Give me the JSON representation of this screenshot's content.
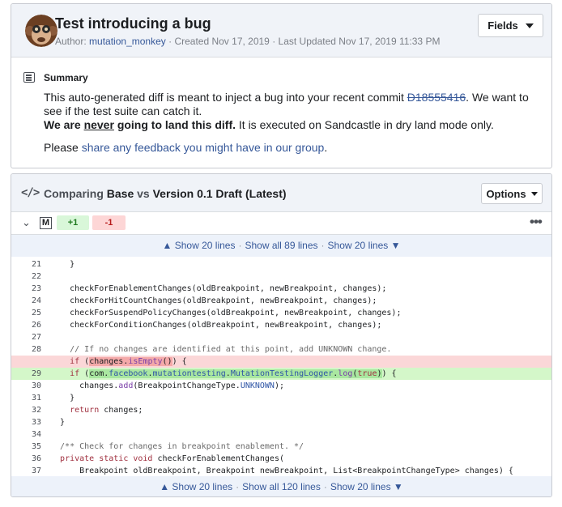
{
  "revision": {
    "title": "Test introducing a bug",
    "author_prefix": "Author:",
    "author": "mutation_monkey",
    "created": "· Created Nov 17, 2019",
    "updated": "· Last Updated Nov 17, 2019 11:33 PM",
    "fields_label": "Fields"
  },
  "summary": {
    "label": "Summary",
    "line1_a": "This auto-generated diff is meant to inject a bug into your recent commit",
    "commit_ref": "D18555416",
    "line1_b": ". We want to see if the test suite can catch it.",
    "bold_a": "We are",
    "bold_never": "never",
    "bold_b": "going to land this diff.",
    "line2_rest": "It is executed on Sandcastle in dry land mode only.",
    "feedback_prefix": "Please",
    "feedback_link": "share any feedback you might have in our group",
    "feedback_suffix": "."
  },
  "diff": {
    "comparing": "Comparing",
    "base": "Base",
    "vs": "vs",
    "version": "Version 0.1 Draft (Latest)",
    "options_label": "Options",
    "file_badge": "M",
    "additions": "+1",
    "deletions": "-1",
    "more_icon": "ellipsis-icon",
    "top_expand": {
      "up": "▲ Show 20 lines",
      "all": "Show all 89 lines",
      "down": "Show 20 lines ▼"
    },
    "bottom_expand": {
      "up": "▲ Show 20 lines",
      "all": "Show all 120 lines",
      "down": "Show 20 lines ▼"
    }
  },
  "colors": {
    "header_bg": "#f0f3f8",
    "link": "#365899",
    "removed_line": "#fbd7d8",
    "added_line": "#d4f7c9"
  }
}
